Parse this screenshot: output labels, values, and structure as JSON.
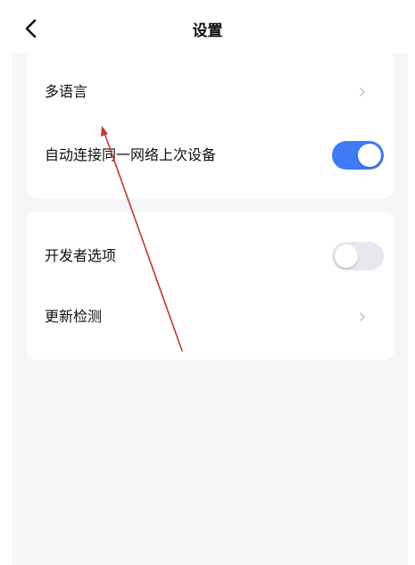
{
  "header": {
    "title": "设置",
    "back_icon": "chevron-left-icon"
  },
  "group1": {
    "items": [
      {
        "label": "多语言",
        "type": "link",
        "icon": "chevron-right-icon"
      },
      {
        "label": "自动连接同一网络上次设备",
        "type": "toggle",
        "on": true
      }
    ]
  },
  "group2": {
    "items": [
      {
        "label": "开发者选项",
        "type": "toggle",
        "on": false
      },
      {
        "label": "更新检测",
        "type": "link",
        "icon": "chevron-right-icon"
      }
    ]
  },
  "colors": {
    "accent": "#3d7bf7",
    "toggle_off": "#e6e8ec",
    "page_bg": "#f5f6f8",
    "annotation": "#c0392b"
  },
  "annotation": {
    "type": "arrow",
    "icon": "arrow-annotation-icon"
  }
}
